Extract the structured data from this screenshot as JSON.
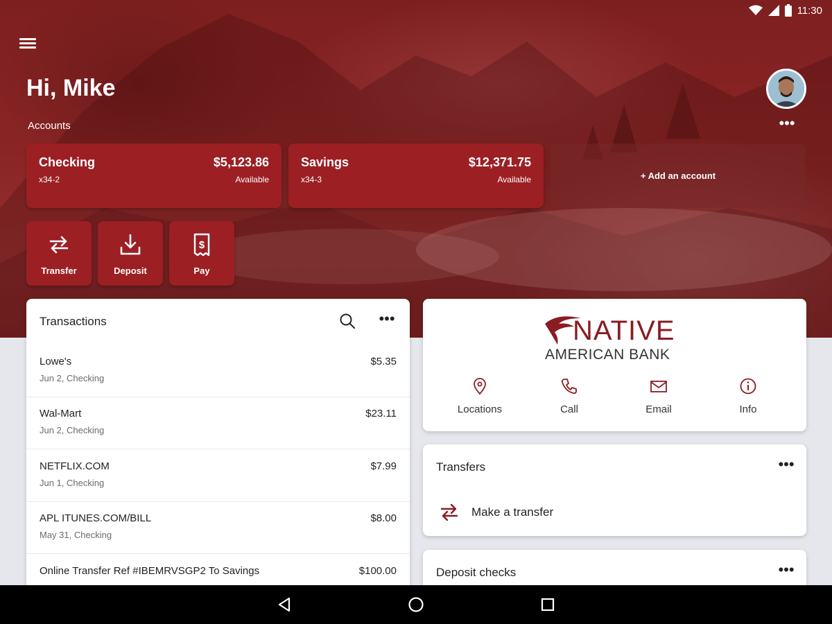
{
  "status": {
    "time": "11:30"
  },
  "header": {
    "greeting": "Hi, Mike",
    "accounts_label": "Accounts",
    "more": "•••"
  },
  "accounts": [
    {
      "name": "Checking",
      "number": "x34-2",
      "balance": "$5,123.86",
      "status": "Available"
    },
    {
      "name": "Savings",
      "number": "x34-3",
      "balance": "$12,371.75",
      "status": "Available"
    }
  ],
  "add_account": "+ Add an account",
  "actions": [
    {
      "label": "Transfer",
      "icon": "transfer-icon"
    },
    {
      "label": "Deposit",
      "icon": "deposit-icon"
    },
    {
      "label": "Pay",
      "icon": "pay-bill-icon"
    }
  ],
  "transactions": {
    "title": "Transactions",
    "more": "•••",
    "rows": [
      {
        "desc": "Lowe's",
        "meta": "Jun 2, Checking",
        "amount": "$5.35"
      },
      {
        "desc": "Wal-Mart",
        "meta": "Jun 2, Checking",
        "amount": "$23.11"
      },
      {
        "desc": "NETFLIX.COM",
        "meta": "Jun 1, Checking",
        "amount": "$7.99"
      },
      {
        "desc": "APL ITUNES.COM/BILL",
        "meta": "May 31, Checking",
        "amount": "$8.00"
      },
      {
        "desc": "Online Transfer Ref #IBEMRVSGP2 To Savings",
        "meta": "",
        "amount": "$100.00"
      }
    ]
  },
  "bank": {
    "logo_line1": "NATIVE",
    "logo_line2": "AMERICAN BANK",
    "contacts": [
      {
        "label": "Locations",
        "icon": "location-pin-icon"
      },
      {
        "label": "Call",
        "icon": "phone-icon"
      },
      {
        "label": "Email",
        "icon": "email-icon"
      },
      {
        "label": "Info",
        "icon": "info-icon"
      }
    ]
  },
  "transfers": {
    "title": "Transfers",
    "more": "•••",
    "action": "Make a transfer"
  },
  "deposit": {
    "title": "Deposit checks",
    "more": "•••"
  },
  "colors": {
    "brand": "#9c1f24",
    "accent": "#8a1c22"
  }
}
